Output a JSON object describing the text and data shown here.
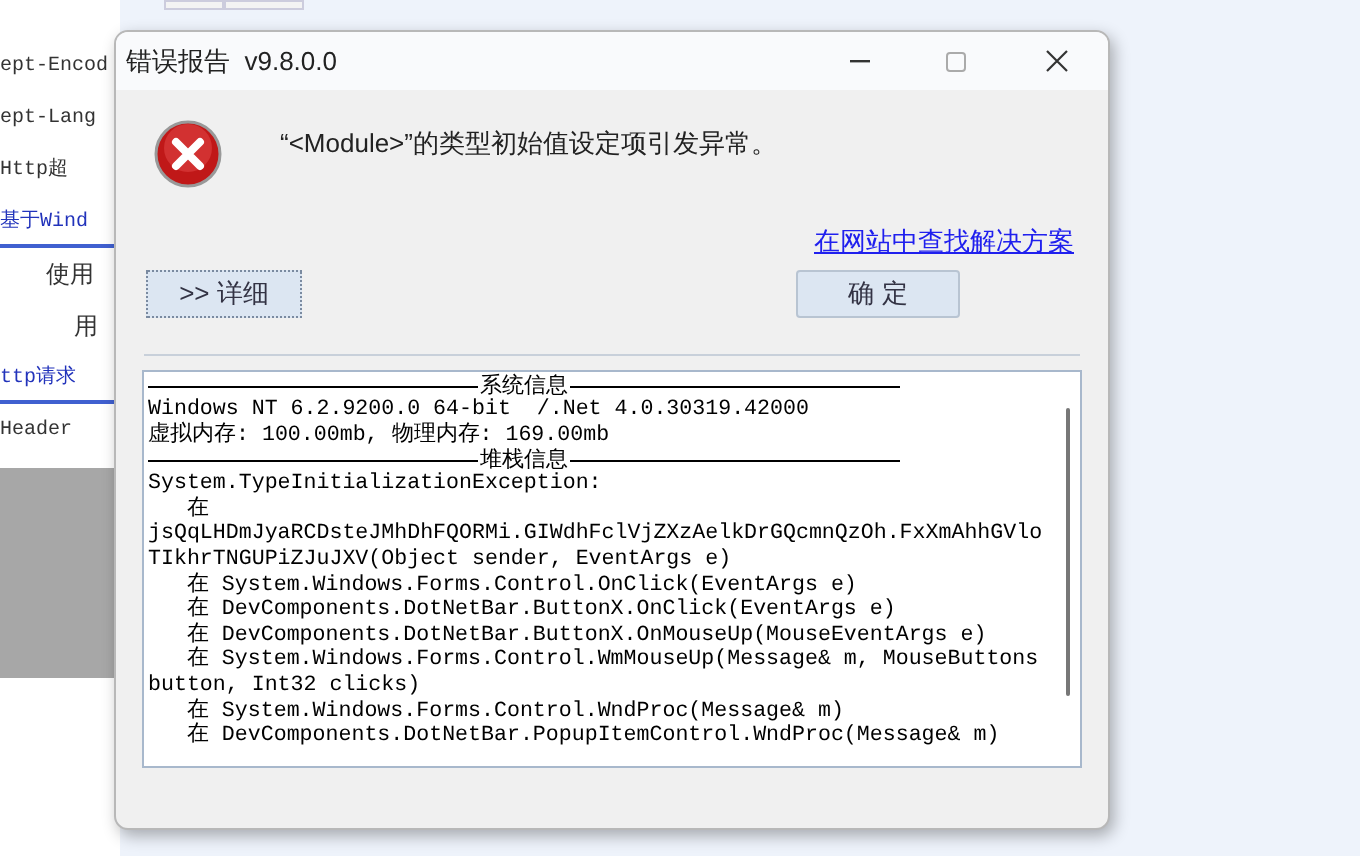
{
  "background_app": {
    "items": [
      {
        "kind": "text",
        "label": "ept-Encod"
      },
      {
        "kind": "text",
        "label": "ept-Lang"
      },
      {
        "kind": "text",
        "label": "Http超"
      },
      {
        "kind": "tab",
        "label": "基于Wind"
      },
      {
        "kind": "indented",
        "label": "使用"
      },
      {
        "kind": "indented_more",
        "label": "用"
      },
      {
        "kind": "tab",
        "label": "ttp请求"
      },
      {
        "kind": "text",
        "label": "Header"
      }
    ]
  },
  "window": {
    "title": "错误报告  v9.8.0.0"
  },
  "message": "“<Module>”的类型初始值设定项引发异常。",
  "help_link": "在网站中查找解决方案",
  "details_button": ">> 详细",
  "ok_button": "确 定",
  "details": [
    {
      "kind": "header",
      "text": "系统信息"
    },
    {
      "kind": "line",
      "text": "Windows NT 6.2.9200.0 64-bit  /.Net 4.0.30319.42000"
    },
    {
      "kind": "line",
      "text": "虚拟内存: 100.00mb, 物理内存: 169.00mb"
    },
    {
      "kind": "header",
      "text": "堆栈信息"
    },
    {
      "kind": "line",
      "text": "System.TypeInitializationException:"
    },
    {
      "kind": "line",
      "text": "   在"
    },
    {
      "kind": "line",
      "text": "jsQqLHDmJyaRCDsteJMhDhFQORMi.GIWdhFclVjZXzAelkDrGQcmnQzOh.FxXmAhhGVlo"
    },
    {
      "kind": "line",
      "text": "TIkhrTNGUPiZJuJXV(Object sender, EventArgs e)"
    },
    {
      "kind": "line",
      "text": "   在 System.Windows.Forms.Control.OnClick(EventArgs e)"
    },
    {
      "kind": "line",
      "text": "   在 DevComponents.DotNetBar.ButtonX.OnClick(EventArgs e)"
    },
    {
      "kind": "line",
      "text": "   在 DevComponents.DotNetBar.ButtonX.OnMouseUp(MouseEventArgs e)"
    },
    {
      "kind": "line",
      "text": "   在 System.Windows.Forms.Control.WmMouseUp(Message& m, MouseButtons"
    },
    {
      "kind": "line",
      "text": "button, Int32 clicks)"
    },
    {
      "kind": "line",
      "text": "   在 System.Windows.Forms.Control.WndProc(Message& m)"
    },
    {
      "kind": "line",
      "text": "   在 DevComponents.DotNetBar.PopupItemControl.WndProc(Message& m)"
    }
  ]
}
